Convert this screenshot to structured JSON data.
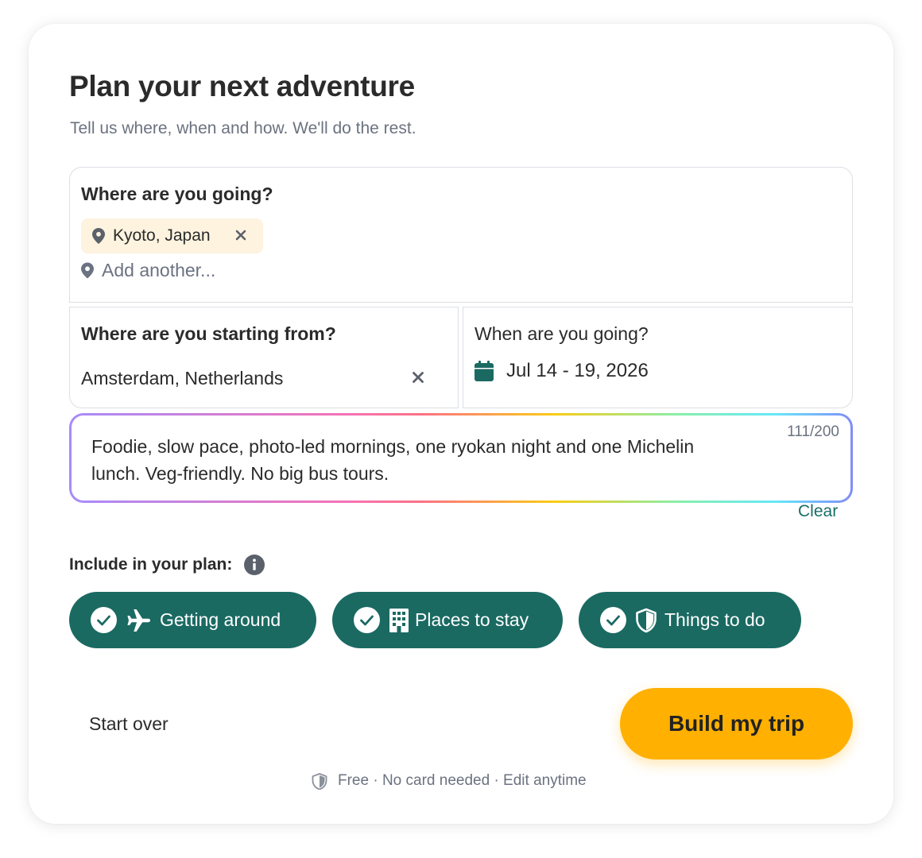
{
  "header": {
    "title": "Plan your next adventure",
    "subtitle": "Tell us where, when and how. We'll do the rest."
  },
  "destination": {
    "label": "Where are you going?",
    "chips": [
      {
        "label": "Kyoto, Japan",
        "icon": "map-pin-icon"
      }
    ],
    "add_placeholder": "Add another..."
  },
  "origin": {
    "label": "Where are you starting from?",
    "value": "Amsterdam, Netherlands"
  },
  "dates": {
    "label": "When are you going?",
    "value": "Jul 14 - 19, 2026",
    "icon": "calendar-icon"
  },
  "preferences": {
    "text": "Foodie, slow pace, photo-led mornings, one ryokan night and one Michelin lunch. Veg-friendly. No big bus tours.",
    "counter": "111/200",
    "clear_label": "Clear"
  },
  "include": {
    "label": "Include in your plan:",
    "options": [
      {
        "label": "Getting around",
        "icon": "airplane-icon",
        "checked": true
      },
      {
        "label": "Places to stay",
        "icon": "building-icon",
        "checked": true
      },
      {
        "label": "Things to do",
        "icon": "shield-icon",
        "checked": true
      }
    ]
  },
  "actions": {
    "start_over": "Start over",
    "build": "Build my trip"
  },
  "footer": {
    "note": "Free · No card needed · Edit anytime"
  },
  "colors": {
    "accent_green": "#1a6a62",
    "cta_yellow": "#ffb000",
    "chip_bg": "#fdf3df"
  }
}
